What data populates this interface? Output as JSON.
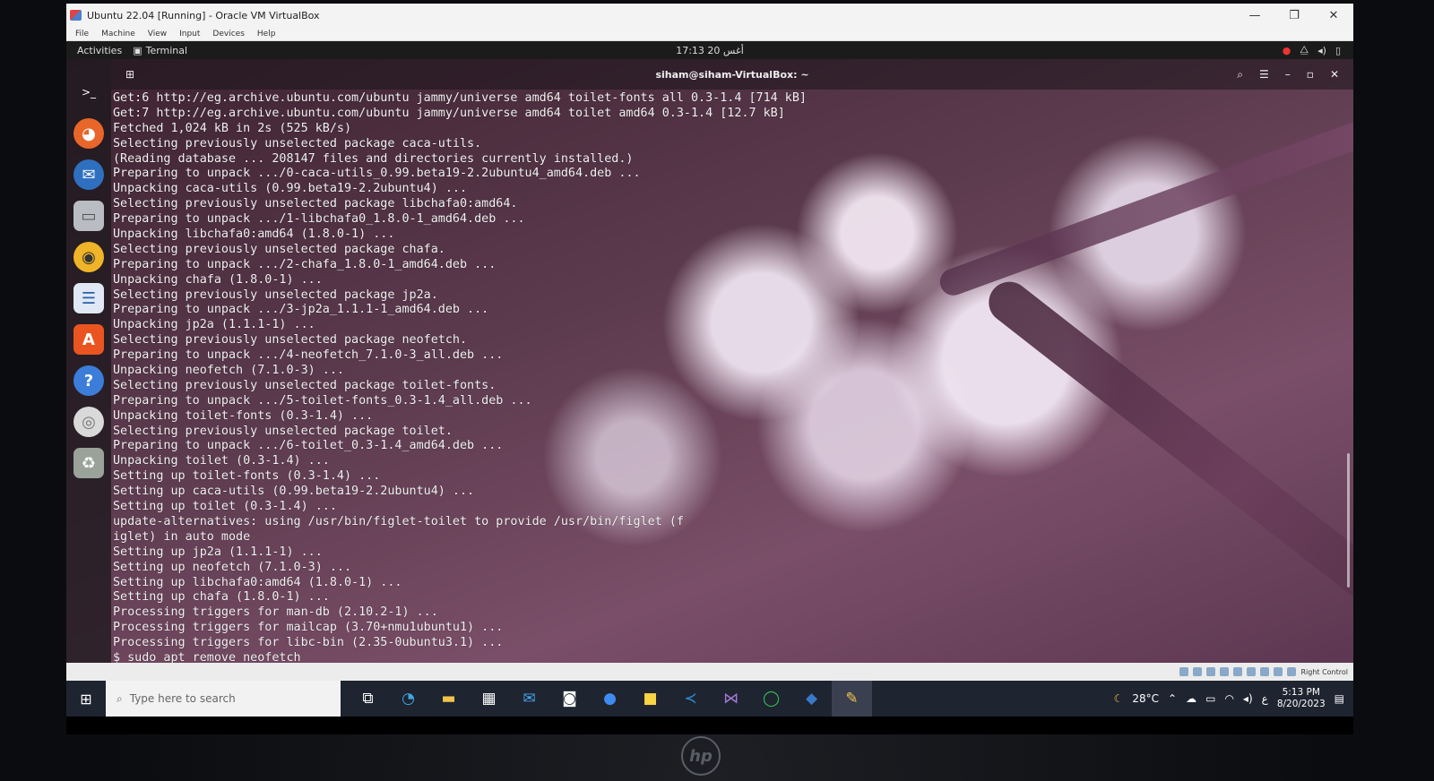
{
  "vbox": {
    "title": "Ubuntu 22.04 [Running] - Oracle VM VirtualBox",
    "menu": [
      "File",
      "Machine",
      "View",
      "Input",
      "Devices",
      "Help"
    ],
    "controls": {
      "minimize": "—",
      "maximize": "❐",
      "close": "✕"
    },
    "status_text": "Right Control"
  },
  "ubuntu": {
    "activities": "Activities",
    "app_label": "Terminal",
    "clock": "17:13 أغس 20",
    "terminal_title": "siham@siham-VirtualBox: ~"
  },
  "terminal_lines": [
    "Get:6 http://eg.archive.ubuntu.com/ubuntu jammy/universe amd64 toilet-fonts all 0.3-1.4 [714 kB]",
    "Get:7 http://eg.archive.ubuntu.com/ubuntu jammy/universe amd64 toilet amd64 0.3-1.4 [12.7 kB]",
    "Fetched 1,024 kB in 2s (525 kB/s)",
    "Selecting previously unselected package caca-utils.",
    "(Reading database ... 208147 files and directories currently installed.)",
    "Preparing to unpack .../0-caca-utils_0.99.beta19-2.2ubuntu4_amd64.deb ...",
    "Unpacking caca-utils (0.99.beta19-2.2ubuntu4) ...",
    "Selecting previously unselected package libchafa0:amd64.",
    "Preparing to unpack .../1-libchafa0_1.8.0-1_amd64.deb ...",
    "Unpacking libchafa0:amd64 (1.8.0-1) ...",
    "Selecting previously unselected package chafa.",
    "Preparing to unpack .../2-chafa_1.8.0-1_amd64.deb ...",
    "Unpacking chafa (1.8.0-1) ...",
    "Selecting previously unselected package jp2a.",
    "Preparing to unpack .../3-jp2a_1.1.1-1_amd64.deb ...",
    "Unpacking jp2a (1.1.1-1) ...",
    "Selecting previously unselected package neofetch.",
    "Preparing to unpack .../4-neofetch_7.1.0-3_all.deb ...",
    "Unpacking neofetch (7.1.0-3) ...",
    "Selecting previously unselected package toilet-fonts.",
    "Preparing to unpack .../5-toilet-fonts_0.3-1.4_all.deb ...",
    "Unpacking toilet-fonts (0.3-1.4) ...",
    "Selecting previously unselected package toilet.",
    "Preparing to unpack .../6-toilet_0.3-1.4_amd64.deb ...",
    "Unpacking toilet (0.3-1.4) ...",
    "Setting up toilet-fonts (0.3-1.4) ...",
    "Setting up caca-utils (0.99.beta19-2.2ubuntu4) ...",
    "Setting up toilet (0.3-1.4) ...",
    "update-alternatives: using /usr/bin/figlet-toilet to provide /usr/bin/figlet (f",
    "iglet) in auto mode",
    "Setting up jp2a (1.1.1-1) ...",
    "Setting up neofetch (7.1.0-3) ...",
    "Setting up libchafa0:amd64 (1.8.0-1) ...",
    "Setting up chafa (1.8.0-1) ...",
    "Processing triggers for man-db (2.10.2-1) ...",
    "Processing triggers for mailcap (3.70+nmu1ubuntu1) ...",
    "Processing triggers for libc-bin (2.35-0ubuntu3.1) ...",
    "$ sudo apt remove neofetch"
  ],
  "dock": [
    {
      "icon": "terminal-icon",
      "glyph": ">_",
      "color": "transparent"
    },
    {
      "icon": "firefox-icon",
      "glyph": "●",
      "color": "#e8662a"
    },
    {
      "icon": "thunderbird-icon",
      "glyph": "✉",
      "color": "#2f6fbf"
    },
    {
      "icon": "files-icon",
      "glyph": "▭",
      "color": "#b9bcc2"
    },
    {
      "icon": "rhythmbox-icon",
      "glyph": "◉",
      "color": "#f0b429"
    },
    {
      "icon": "writer-icon",
      "glyph": "☰",
      "color": "#dfe8f4"
    },
    {
      "icon": "software-icon",
      "glyph": "A",
      "color": "#e95420"
    },
    {
      "icon": "help-icon",
      "glyph": "?",
      "color": "#3b7dd8"
    },
    {
      "icon": "dvd-icon",
      "glyph": "◎",
      "color": "#d9d9d9"
    },
    {
      "icon": "trash-icon",
      "glyph": "♻",
      "color": "#9aa29a"
    }
  ],
  "taskbar": {
    "search_placeholder": "Type here to search",
    "weather": "28°C",
    "time": "5:13 PM",
    "date": "8/20/2023",
    "lang": "ع"
  },
  "colors": {
    "ubuntu_orange": "#e95420",
    "taskbar": "#1e2430"
  }
}
